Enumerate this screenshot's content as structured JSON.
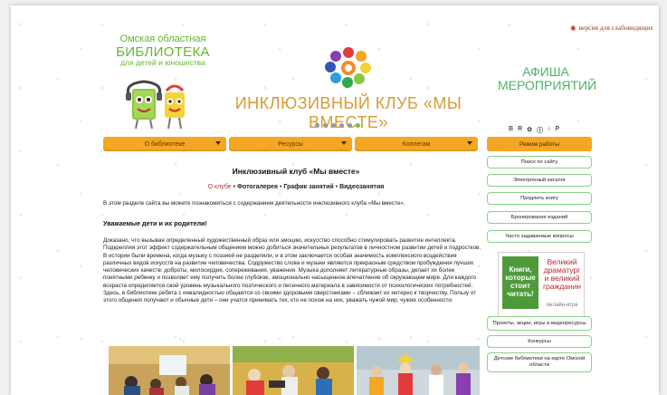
{
  "vision_link": "версия для слабовидящих",
  "library": {
    "line1": "Омская областная",
    "line2": "БИБЛИОТЕКА",
    "line3": "для детей и юношества"
  },
  "club_title": "ИНКЛЮЗИВНЫЙ КЛУБ «МЫ ВМЕСТЕ»",
  "slider": {
    "count": 6,
    "active_index": 5
  },
  "afisha": {
    "line1": "АФИША",
    "line2": "МЕРОПРИЯТИЙ"
  },
  "social": [
    "В",
    "R",
    "✿",
    "Ⓘ",
    "♪",
    "P"
  ],
  "menu": [
    {
      "label": "О библиотеке"
    },
    {
      "label": "Ресурсы"
    },
    {
      "label": "Коллегам"
    }
  ],
  "mode_button": "Режим работы",
  "side_buttons": [
    "Поиск по сайту",
    "Электронный каталог",
    "Продлить книгу",
    "Бронирование изданий",
    "Часто задаваемые вопросы"
  ],
  "banner": {
    "book": "Книги, которые стоит читать!",
    "right": "Великий драматург и великий гражданин",
    "online": "онлайн-игра"
  },
  "side_buttons_lower": [
    "Проекты, акции, игры и видеоресурсы",
    "Конкурсы",
    "Детские библиотеки на карте Омской области"
  ],
  "page_title": "Инклюзивный клуб «Мы вместе»",
  "breadcrumbs": {
    "current": "О клубе",
    "sep": " • ",
    "items": [
      "Фотогалерея",
      "График занятий",
      "Видеозанятия"
    ]
  },
  "intro": "В этом разделе сайта вы можете познакомиться с содержанием деятельности инклюзивного клуба «Мы вместе».",
  "address": "Уважаемые дети и их родители!",
  "paragraphs": [
    "Доказано, что вызывая определенный художественный образ или эмоцию, искусство способно стимулировать развитие интеллекта. Подкрепляя этот эффект содержательным общением можно добиться значительных результатов в личностном развитии детей и подростков.",
    "В истории были времена, когда музыку с поэзией не разделяли, и в этом заключается особая значимость комплексного воздействия различных видов искусств на развитие человечества. Содружество слова и музыки являются прекрасным средством пробуждения лучших человеческих качеств: доброты, милосердия, сопереживания, уважения. Музыка дополняет литературные образы, делает их более понятными ребенку и позволяет ему получить более глубокое, эмоционально насыщенное впечатление об окружающем мире. Для каждого возраста определяется свой уровень музыкального поэтического и песенного материала в зависимости от психологических потребностей.",
    "Здесь, в библиотеке ребята с инвалидностью общаются со своими здоровыми сверстниками – сближает их интерес к творчеству. Пользу от этого общения получают и обычные дети – они учатся принимать тех, кто не похож на них, уважать чужой мир, чужие особенности."
  ],
  "colors": {
    "menu": "#f5a623",
    "green": "#66b52e",
    "red": "#c0302a",
    "title": "#d79b32"
  }
}
